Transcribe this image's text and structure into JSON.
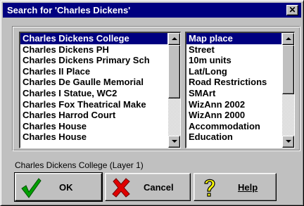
{
  "window": {
    "title": "Search for 'Charles Dickens'",
    "close_symbol": "✕"
  },
  "results": {
    "items": [
      "Charles Dickens College",
      "Charles Dickens PH",
      "Charles Dickens Primary Sch",
      "Charles II Place",
      "Charles De Gaulle Memorial",
      "Charles I Statue, WC2",
      "Charles Fox Theatrical Make",
      "Charles Harrod Court",
      "Charles House",
      "Charles House"
    ],
    "selected_index": 0
  },
  "layers": {
    "items": [
      "Map place",
      "Street",
      "10m units",
      "Lat/Long",
      "Road Restrictions",
      "SMArt",
      "WizAnn 2002",
      "WizAnn 2000",
      "Accommodation",
      "Education"
    ],
    "selected_index": 0
  },
  "status": {
    "text": "Charles Dickens College (Layer 1)"
  },
  "buttons": {
    "ok": {
      "label": "OK",
      "icon": "checkmark-icon",
      "color": "#008000"
    },
    "cancel": {
      "label": "Cancel",
      "icon": "red-x-icon",
      "color": "#ff0000"
    },
    "help": {
      "label": "Help",
      "icon": "question-mark-icon",
      "color": "#ffff00"
    }
  }
}
